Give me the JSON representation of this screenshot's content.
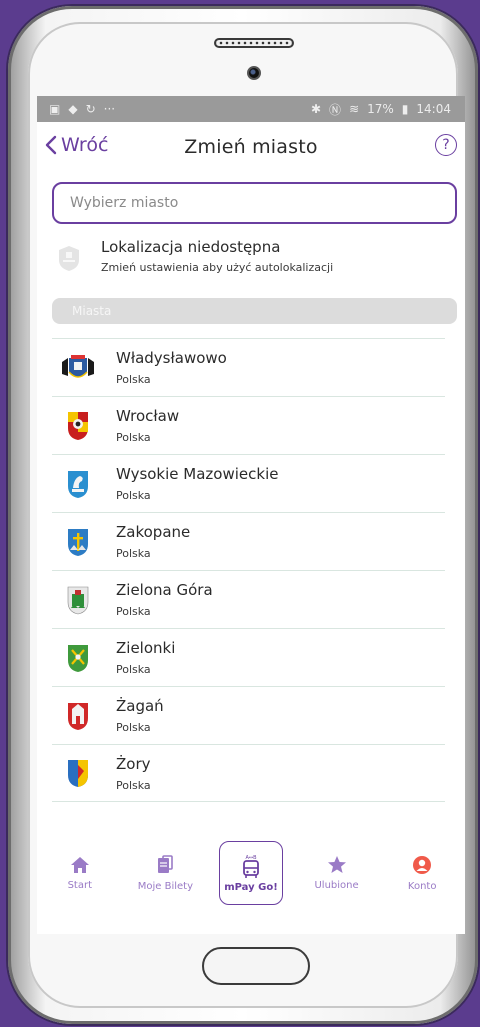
{
  "statusbar": {
    "battery": "17%",
    "time": "14:04"
  },
  "header": {
    "back_label": "Wróć",
    "title": "Zmień miasto",
    "help_label": "?"
  },
  "search": {
    "placeholder": "Wybierz miasto",
    "value": ""
  },
  "location": {
    "title": "Lokalizacja niedostępna",
    "subtitle": "Zmień ustawienia aby użyć autolokalizacji"
  },
  "section_label": "Miasta",
  "cities": [
    {
      "name": "Władysławowo",
      "country": "Polska"
    },
    {
      "name": "Wrocław",
      "country": "Polska"
    },
    {
      "name": "Wysokie Mazowieckie",
      "country": "Polska"
    },
    {
      "name": "Zakopane",
      "country": "Polska"
    },
    {
      "name": "Zielona Góra",
      "country": "Polska"
    },
    {
      "name": "Zielonki",
      "country": "Polska"
    },
    {
      "name": "Żagań",
      "country": "Polska"
    },
    {
      "name": "Żory",
      "country": "Polska"
    }
  ],
  "tabs": [
    {
      "label": "Start",
      "icon": "home-icon"
    },
    {
      "label": "Moje Bilety",
      "icon": "tickets-icon"
    },
    {
      "label": "mPay Go!",
      "icon": "bus-icon"
    },
    {
      "label": "Ulubione",
      "icon": "star-icon"
    },
    {
      "label": "Konto",
      "icon": "account-icon"
    }
  ],
  "colors": {
    "accent": "#6a3fa0",
    "tab_inactive": "#9a7bc6",
    "account": "#f05a4a",
    "background": "#5b3c8e"
  }
}
